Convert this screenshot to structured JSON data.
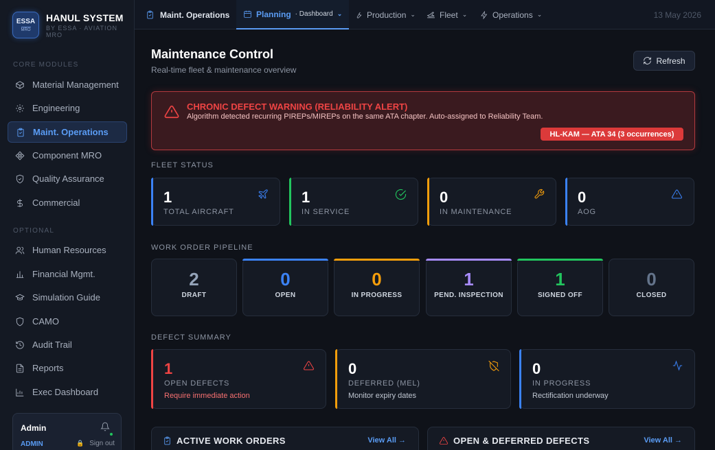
{
  "app": {
    "logo_top": "ESSA",
    "logo_bottom": "MRO",
    "title": "HANUL SYSTEM",
    "subtitle": "BY ESSA · AVIATION MRO"
  },
  "sidebar": {
    "core_label": "CORE MODULES",
    "core_items": [
      {
        "label": "Material Management",
        "icon": "box-icon"
      },
      {
        "label": "Engineering",
        "icon": "gear-icon"
      },
      {
        "label": "Maint. Operations",
        "icon": "clipboard-icon",
        "active": true
      },
      {
        "label": "Component MRO",
        "icon": "component-icon"
      },
      {
        "label": "Quality Assurance",
        "icon": "shield-icon"
      },
      {
        "label": "Commercial",
        "icon": "dollar-icon"
      }
    ],
    "optional_label": "OPTIONAL",
    "optional_items": [
      {
        "label": "Human Resources",
        "icon": "users-icon"
      },
      {
        "label": "Financial Mgmt.",
        "icon": "bar-chart-icon"
      },
      {
        "label": "Simulation Guide",
        "icon": "graduation-cap-icon"
      },
      {
        "label": "CAMO",
        "icon": "shield-outline-icon"
      },
      {
        "label": "Audit Trail",
        "icon": "history-icon"
      },
      {
        "label": "Reports",
        "icon": "file-icon"
      },
      {
        "label": "Exec Dashboard",
        "icon": "chart-icon"
      }
    ],
    "user": {
      "name": "Admin",
      "role": "ADMIN",
      "signout": "Sign out"
    }
  },
  "topbar": {
    "section": "Maint. Operations",
    "tabs": [
      {
        "label": "Planning",
        "sub": "· Dashboard",
        "active": true
      },
      {
        "label": "Production"
      },
      {
        "label": "Fleet"
      },
      {
        "label": "Operations"
      }
    ],
    "date": "13 May 2026"
  },
  "main": {
    "title": "Maintenance Control",
    "subtitle": "Real-time fleet & maintenance overview",
    "refresh_label": "Refresh",
    "alert": {
      "title": "CHRONIC DEFECT WARNING (RELIABILITY ALERT)",
      "description": "Algorithm detected recurring PIREPs/MIREPs on the same ATA chapter. Auto-assigned to Reliability Team.",
      "pill": "HL-KAM — ATA 34 (3 occurrences)"
    },
    "fleet_status": {
      "label": "FLEET STATUS",
      "cards": [
        {
          "value": "1",
          "label": "TOTAL AIRCRAFT",
          "icon": "plane-icon",
          "color": "#3b82f6"
        },
        {
          "value": "1",
          "label": "IN SERVICE",
          "icon": "check-circle-icon",
          "color": "#22c55e"
        },
        {
          "value": "0",
          "label": "IN MAINTENANCE",
          "icon": "wrench-icon",
          "color": "#f59e0b"
        },
        {
          "value": "0",
          "label": "AOG",
          "icon": "warning-icon",
          "color": "#3b82f6"
        }
      ]
    },
    "pipeline": {
      "label": "WORK ORDER PIPELINE",
      "stages": [
        {
          "value": "2",
          "label": "DRAFT",
          "color": "#94a3b8"
        },
        {
          "value": "0",
          "label": "OPEN",
          "color": "#3b82f6"
        },
        {
          "value": "0",
          "label": "IN PROGRESS",
          "color": "#f59e0b"
        },
        {
          "value": "1",
          "label": "PEND. INSPECTION",
          "color": "#a78bfa"
        },
        {
          "value": "1",
          "label": "SIGNED OFF",
          "color": "#22c55e"
        },
        {
          "value": "0",
          "label": "CLOSED",
          "color": "#64748b"
        }
      ]
    },
    "defects": {
      "label": "DEFECT SUMMARY",
      "cards": [
        {
          "value": "1",
          "label": "OPEN DEFECTS",
          "sub": "Require immediate action",
          "icon": "warning-icon",
          "color": "#ef4444"
        },
        {
          "value": "0",
          "label": "DEFERRED (MEL)",
          "sub": "Monitor expiry dates",
          "icon": "shield-off-icon",
          "color": "#f59e0b"
        },
        {
          "value": "0",
          "label": "IN PROGRESS",
          "sub": "Rectification underway",
          "icon": "activity-icon",
          "color": "#3b82f6"
        }
      ]
    },
    "panels": [
      {
        "title": "ACTIVE WORK ORDERS",
        "link": "View All →",
        "icon": "clipboard-icon"
      },
      {
        "title": "OPEN & DEFERRED DEFECTS",
        "link": "View All →",
        "icon": "warning-icon"
      }
    ]
  }
}
